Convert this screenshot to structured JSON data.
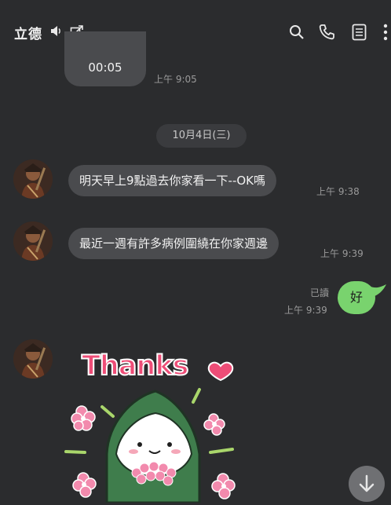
{
  "header": {
    "title": "立德",
    "icons": [
      "speaker-icon",
      "open-external-icon",
      "search-icon",
      "phone-icon",
      "notes-icon",
      "more-icon"
    ]
  },
  "messages": {
    "top_partial": {
      "text": "00:05",
      "time": "上午 9:05"
    },
    "date_separator": "10月4日(三)",
    "m1": {
      "text": "明天早上9點過去你家看一下--OK嗎",
      "time": "上午 9:38"
    },
    "m2": {
      "text": "最近一週有許多病例圍繞在你家週邊",
      "time": "上午 9:39"
    },
    "mine": {
      "read_label": "已讀",
      "time": "上午 9:39",
      "text": "好"
    },
    "sticker": {
      "text": "Thanks"
    }
  },
  "colors": {
    "background": "#2b2c2e",
    "incoming_bubble": "#4a4b4e",
    "outgoing_bubble": "#79d36e",
    "sticker_pink": "#ee4d77",
    "sticker_green": "#3f7d4c"
  }
}
